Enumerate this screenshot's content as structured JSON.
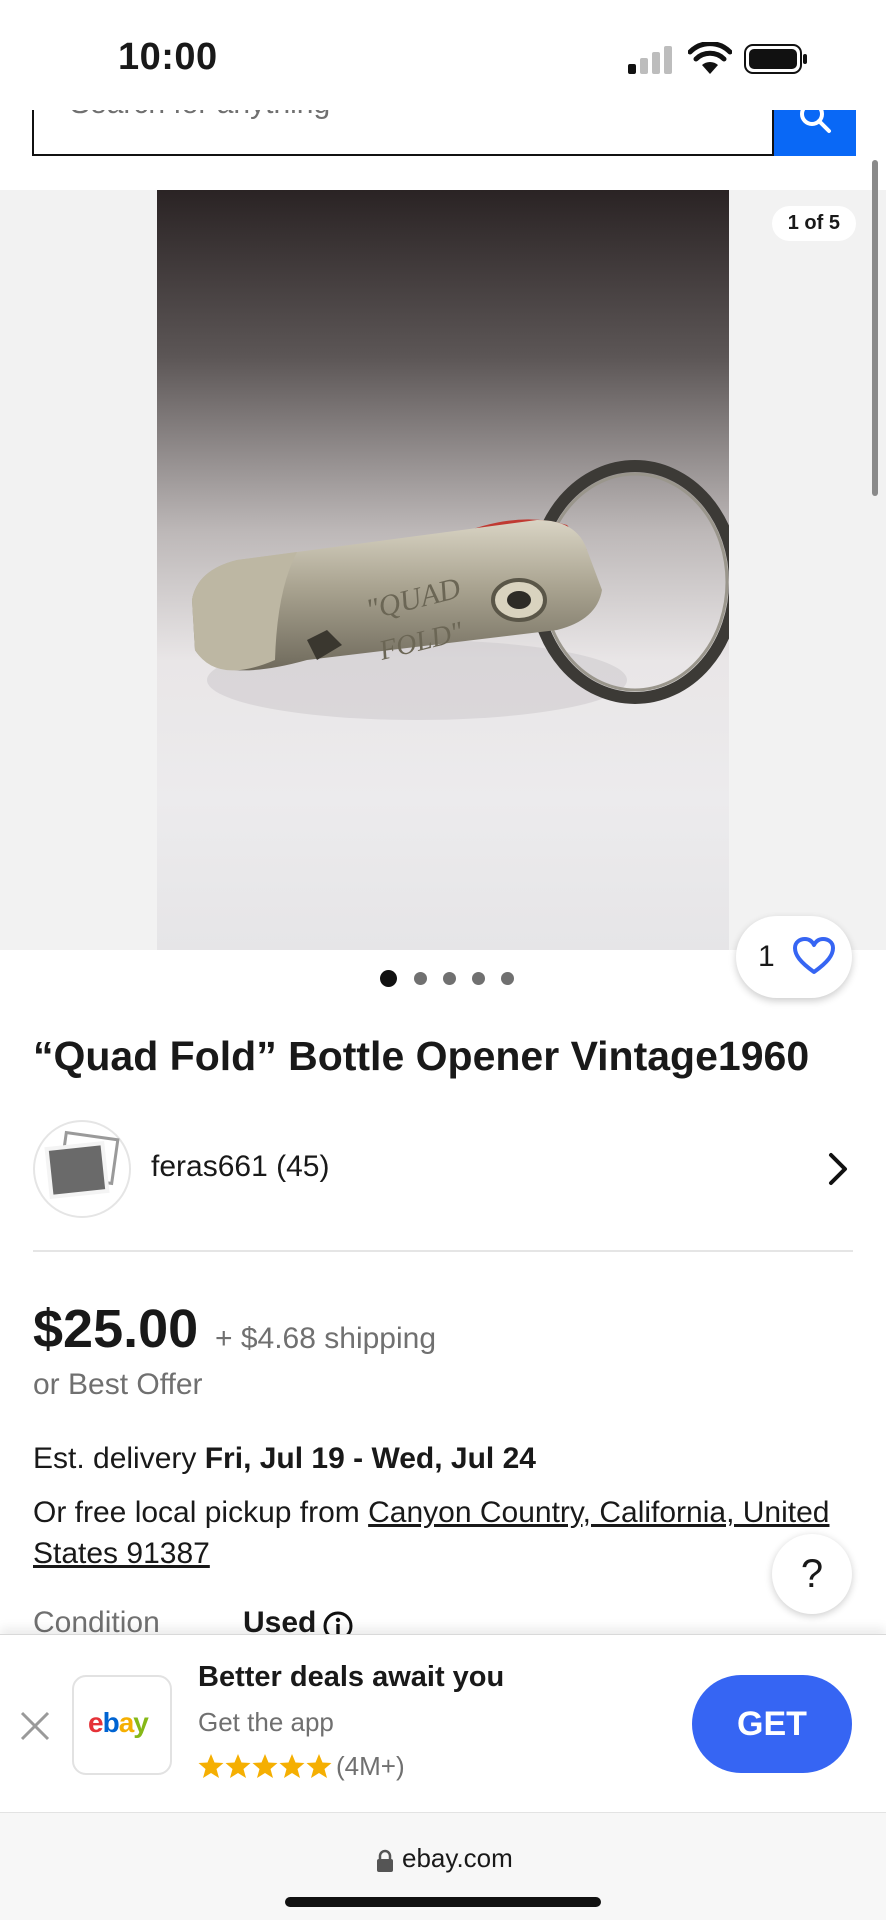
{
  "status": {
    "time": "10:00"
  },
  "search": {
    "placeholder": "Search for anything"
  },
  "gallery": {
    "counter": "1 of 5",
    "total_images": 5,
    "active_index": 0,
    "watch_count": "1"
  },
  "listing": {
    "title": "“Quad Fold” Bottle Opener Vintage1960",
    "seller": "feras661 (45)",
    "price": "$25.00",
    "shipping": "+ $4.68 shipping",
    "best_offer": "or Best Offer",
    "delivery_prefix": "Est. delivery ",
    "delivery_dates": "Fri, Jul 19 - Wed, Jul 24",
    "pickup_prefix": "Or free local pickup from ",
    "pickup_location": "Canyon Country, California, United States 91387",
    "condition_label": "Condition",
    "condition_value": "Used"
  },
  "help": {
    "label": "?"
  },
  "banner": {
    "title": "Better deals await you",
    "subtitle": "Get the app",
    "rating_count": "(4M+)",
    "stars": 5,
    "get_label": "GET",
    "logo": {
      "e": "e",
      "b": "b",
      "a": "a",
      "y": "y"
    }
  },
  "urlbar": {
    "domain": "ebay.com"
  },
  "colors": {
    "accent": "#3665f3",
    "search_button": "#0968f6",
    "star": "#f5af02"
  }
}
